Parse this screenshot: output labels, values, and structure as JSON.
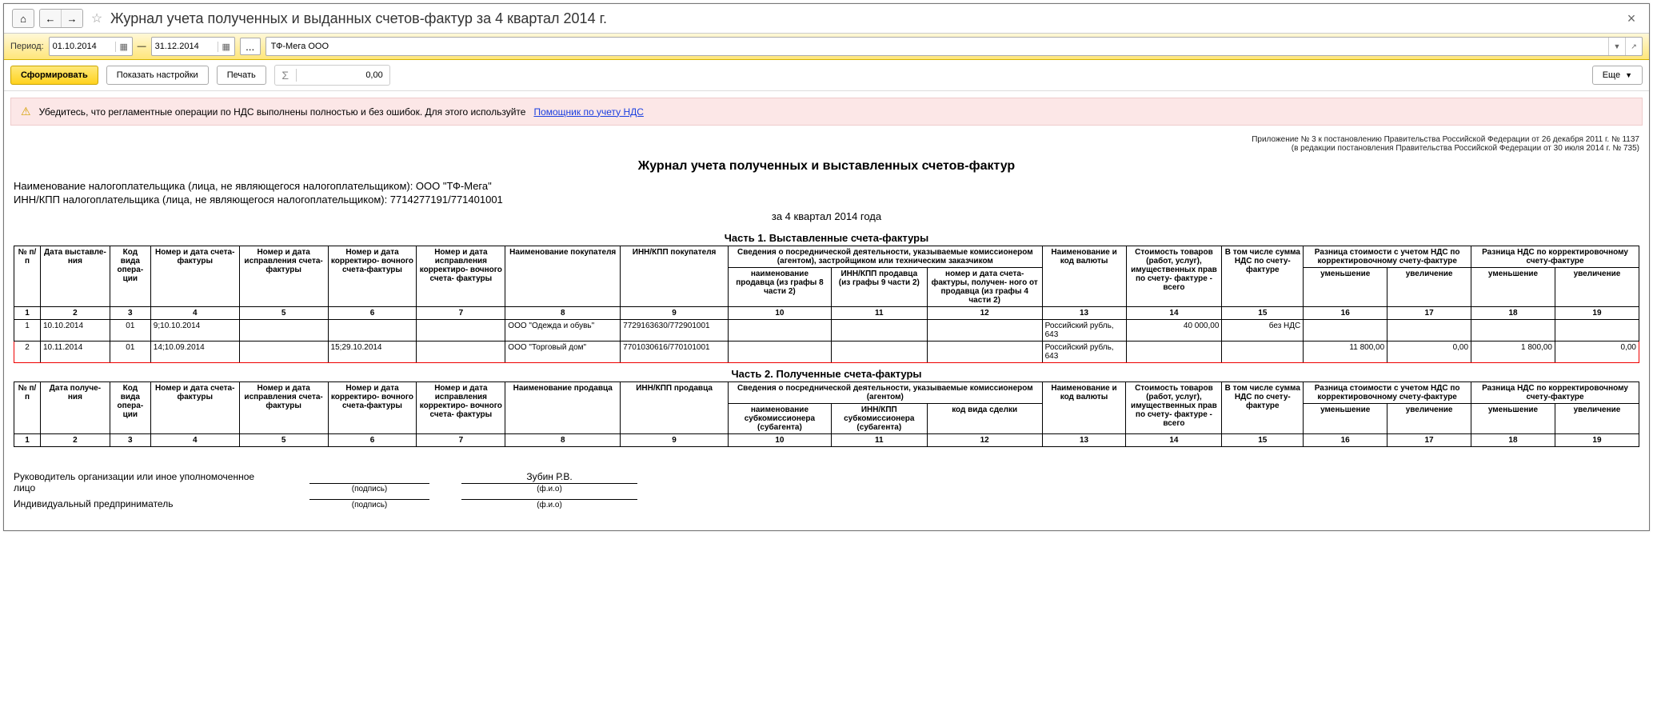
{
  "title": "Журнал учета полученных и выданных счетов-фактур за 4 квартал 2014 г.",
  "period": {
    "label": "Период:",
    "from": "01.10.2014",
    "to": "31.12.2014",
    "sep": "—"
  },
  "org": "ТФ-Мега ООО",
  "toolbar": {
    "form": "Сформировать",
    "settings": "Показать настройки",
    "print": "Печать",
    "sum": "0,00",
    "more": "Еще"
  },
  "alert": {
    "text": "Убедитесь, что регламентные операции по НДС выполнены полностью и без ошибок. Для этого используйте",
    "link": "Помощник по учету НДС"
  },
  "appendix": {
    "l1": "Приложение № 3 к постановлению Правительства Российской Федерации от 26 декабря 2011 г. № 1137",
    "l2": "(в редакции постановления Правительства Российской Федерации от 30 июля 2014 г. № 735)"
  },
  "report": {
    "title": "Журнал учета полученных и выставленных счетов-фактур",
    "payer": "Наименование налогоплательщика (лица, не являющегося налогоплательщиком): ООО \"ТФ-Мега\"",
    "inn": "ИНН/КПП налогоплательщика (лица, не являющегося налогоплательщиком): 7714277191/771401001",
    "period": "за 4 квартал 2014 года"
  },
  "part1": {
    "title": "Часть 1. Выставленные счета-фактуры",
    "h": {
      "c1": "№ п/п",
      "c2": "Дата выставле-\nния",
      "c3": "Код вида опера-\nции",
      "c4": "Номер и дата счета-фактуры",
      "c5": "Номер и дата исправления счета-фактуры",
      "c6": "Номер и дата корректиро-\nвочного счета-фактуры",
      "c7": "Номер и дата исправления корректиро-\nвочного счета-\nфактуры",
      "c8": "Наименование покупателя",
      "c9": "ИНН/КПП покупателя",
      "c10g": "Сведения о посреднической деятельности, указываемые комиссионером (агентом), застройщиком или техническим заказчиком",
      "c10": "наименование продавца (из графы 8 части 2)",
      "c11": "ИНН/КПП продавца (из графы 9 части 2)",
      "c12": "номер и дата счета-фактуры, получен-\nного от продавца (из графы 4 части 2)",
      "c13": "Наименование и код валюты",
      "c14": "Стоимость товаров (работ, услуг), имущественных прав по счету-\nфактуре - всего",
      "c15": "В том числе сумма НДС по счету-фактуре",
      "c16g": "Разница стоимости с учетом НДС по корректировочному счету-фактуре",
      "c16": "уменьшение",
      "c17": "увеличение",
      "c18g": "Разница НДС по корректировочному счету-фактуре",
      "c18": "уменьшение",
      "c19": "увеличение"
    },
    "rows": [
      {
        "n": "1",
        "d": "10.10.2014",
        "op": "01",
        "num": "9;10.10.2014",
        "corr": "",
        "kcorr": "",
        "ikcorr": "",
        "buyer": "ООО \"Одежда и обувь\"",
        "inn": "7729163630/772901001",
        "s10": "",
        "s11": "",
        "s12": "",
        "cur": "Российский рубль, 643",
        "sum": "40 000,00",
        "nds": "без НДС",
        "d16": "",
        "d17": "",
        "d18": "",
        "d19": ""
      },
      {
        "n": "2",
        "d": "10.11.2014",
        "op": "01",
        "num": "14;10.09.2014",
        "corr": "",
        "kcorr": "15;29.10.2014",
        "ikcorr": "",
        "buyer": "ООО \"Торговый дом\"",
        "inn": "7701030616/770101001",
        "s10": "",
        "s11": "",
        "s12": "",
        "cur": "Российский рубль, 643",
        "sum": "",
        "nds": "",
        "d16": "11 800,00",
        "d17": "0,00",
        "d18": "1 800,00",
        "d19": "0,00",
        "hl": true
      }
    ]
  },
  "part2": {
    "title": "Часть 2. Полученные счета-фактуры",
    "h": {
      "c1": "№ п/п",
      "c2": "Дата получе-\nния",
      "c3": "Код вида опера-\nции",
      "c4": "Номер и дата счета-фактуры",
      "c5": "Номер и дата исправления счета-фактуры",
      "c6": "Номер и дата корректиро-\nвочного счета-фактуры",
      "c7": "Номер и дата исправления корректиро-\nвочного счета-\nфактуры",
      "c8": "Наименование продавца",
      "c9": "ИНН/КПП продавца",
      "c10g": "Сведения о посреднической деятельности, указываемые комиссионером (агентом)",
      "c10": "наименование субкомиссионера (субагента)",
      "c11": "ИНН/КПП субкомиссионера (субагента)",
      "c12": "код вида сделки",
      "c13": "Наименование и код валюты",
      "c14": "Стоимость товаров (работ, услуг), имущественных прав по счету-\nфактуре - всего",
      "c15": "В том числе сумма НДС по счету-фактуре",
      "c16g": "Разница стоимости с учетом НДС по корректировочному счету-фактуре",
      "c16": "уменьшение",
      "c17": "увеличение",
      "c18g": "Разница НДС по корректировочному счету-фактуре",
      "c18": "уменьшение",
      "c19": "увеличение"
    }
  },
  "sign": {
    "head": "Руководитель организации или иное уполномоченное лицо",
    "ip": "Индивидуальный предприниматель",
    "sig": "(подпись)",
    "fio": "(ф.и.о)",
    "headName": "Зубин Р.В."
  },
  "cols": [
    "1",
    "2",
    "3",
    "4",
    "5",
    "6",
    "7",
    "8",
    "9",
    "10",
    "11",
    "12",
    "13",
    "14",
    "15",
    "16",
    "17",
    "18",
    "19"
  ]
}
